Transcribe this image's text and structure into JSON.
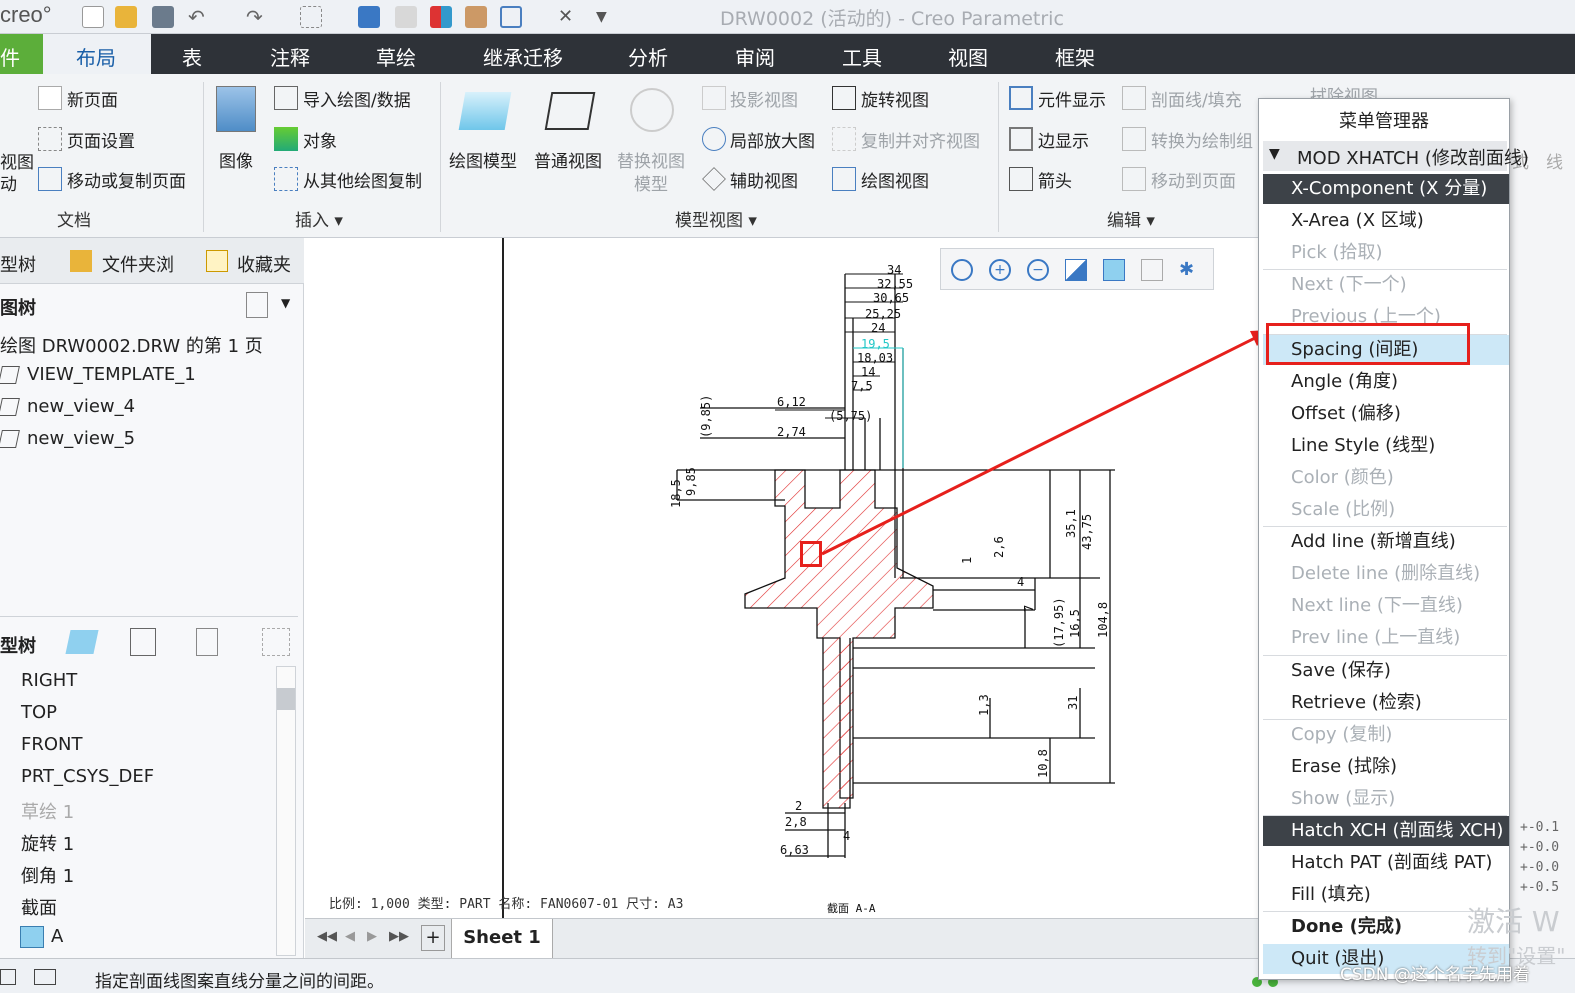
{
  "window": {
    "logo": "creo°",
    "title": "DRW0002 (活动的) - Creo Parametric"
  },
  "tabs": [
    "件",
    "布局",
    "表",
    "注释",
    "草绘",
    "继承迁移",
    "分析",
    "审阅",
    "工具",
    "视图",
    "框架"
  ],
  "ribbon": {
    "doc": {
      "new_page": "新页面",
      "page_setup": "页面设置",
      "move_copy": "移动或复制页面",
      "group": "文档",
      "left_cut1": "视图",
      "left_cut2": "动"
    },
    "insert": {
      "image": "图像",
      "import": "导入绘图/数据",
      "object": "对象",
      "copy_other": "从其他绘图复制",
      "group": "插入"
    },
    "model_views": {
      "drawing_model": "绘图模型",
      "general": "普通视图",
      "replace1": "替换视图",
      "replace2": "模型",
      "projection": "投影视图",
      "detail": "局部放大图",
      "auxiliary": "辅助视图",
      "revolve": "旋转视图",
      "copy_align": "复制并对齐视图",
      "drawing_view": "绘图视图",
      "group": "模型视图"
    },
    "edit": {
      "component_display": "元件显示",
      "edge_display": "边显示",
      "arrow": "箭头",
      "xsec": "剖面线/填充",
      "convert": "转换为绘制组",
      "move_to_page": "移动到页面",
      "erase_view": "拭除视图",
      "group": "编辑"
    }
  },
  "left": {
    "tabs": [
      "型树",
      "文件夹浏",
      "收藏夹"
    ],
    "drawing_tree_label": "图树",
    "drawing_tree": [
      "绘图 DRW0002.DRW 的第 1 页",
      "VIEW_TEMPLATE_1",
      "new_view_4",
      "new_view_5"
    ],
    "model_tree_label": "型树",
    "model_tree": [
      "RIGHT",
      "TOP",
      "FRONT",
      "PRT_CSYS_DEF",
      "草绘 1",
      "旋转 1",
      "倒角 1",
      "截面",
      "A"
    ]
  },
  "drawing": {
    "dims_top": [
      "34",
      "32,55",
      "30,65",
      "25,25",
      "24",
      "19,5",
      "18,03",
      "14",
      "7,5",
      "(5,75)",
      "6,12",
      "2,74",
      "(9,85)"
    ],
    "dims_left": [
      "18,5",
      "9,85"
    ],
    "dims_right": [
      "35,1",
      "43,75",
      "2,6",
      "1",
      "4",
      "7",
      "(17,95)",
      "16,5",
      "104,8",
      "1,3",
      "31",
      "10,8"
    ],
    "dims_bottom": [
      "2",
      "2,8",
      "6,63",
      "4"
    ],
    "title_block": "比例: 1,000   类型: PART   名称: FAN0607-01   尺寸: A3",
    "section_label": "截面 A-A"
  },
  "sheetbar": {
    "sheet": "Sheet 1",
    "add": "+"
  },
  "status": {
    "text": "指定剖面线图案直线分量之间的间距。"
  },
  "menu_manager": {
    "title": "菜单管理器",
    "header": "MOD XHATCH (修改剖面线)",
    "items": [
      {
        "label": "X-Component (X 分量)",
        "state": "dark"
      },
      {
        "label": "X-Area (X 区域)",
        "state": "normal"
      },
      {
        "label": "Pick (拾取)",
        "state": "dim"
      },
      {
        "label": "Next (下一个)",
        "state": "dim"
      },
      {
        "label": "Previous (上一个)",
        "state": "dim"
      },
      {
        "label": "Spacing (间距)",
        "state": "sel"
      },
      {
        "label": "Angle (角度)",
        "state": "normal"
      },
      {
        "label": "Offset (偏移)",
        "state": "normal"
      },
      {
        "label": "Line Style (线型)",
        "state": "normal"
      },
      {
        "label": "Color (颜色)",
        "state": "dim"
      },
      {
        "label": "Scale (比例)",
        "state": "dim"
      },
      {
        "label": "Add line (新增直线)",
        "state": "normal"
      },
      {
        "label": "Delete line (删除直线)",
        "state": "dim"
      },
      {
        "label": "Next line (下一直线)",
        "state": "dim"
      },
      {
        "label": "Prev line (上一直线)",
        "state": "dim"
      },
      {
        "label": "Save (保存)",
        "state": "normal"
      },
      {
        "label": "Retrieve (检索)",
        "state": "normal"
      },
      {
        "label": "Copy (复制)",
        "state": "dim"
      },
      {
        "label": "Erase (拭除)",
        "state": "normal"
      },
      {
        "label": "Show (显示)",
        "state": "dim"
      },
      {
        "label": "Hatch XCH (剖面线 XCH)",
        "state": "dark"
      },
      {
        "label": "Hatch PAT (剖面线 PAT)",
        "state": "normal"
      },
      {
        "label": "Fill (填充)",
        "state": "normal"
      },
      {
        "label": "Done (完成)",
        "state": "bold"
      },
      {
        "label": "Quit (退出)",
        "state": "sel"
      }
    ]
  },
  "right_strip": {
    "side": "式",
    "side2": "线",
    "tol": [
      "+-0.1",
      "+-0.0",
      "+-0.0",
      "+-0.5"
    ]
  },
  "watermark": {
    "line1": "激活 W",
    "line2": "转到\"设置\"",
    "csdn": "CSDN @这个名字先用着"
  },
  "colors": {
    "accent_red": "#e6201c",
    "hatch": "#e03030",
    "menu_dark": "#3d4248",
    "menu_sel": "#cde8f7",
    "file_tab": "#5cae3a"
  }
}
